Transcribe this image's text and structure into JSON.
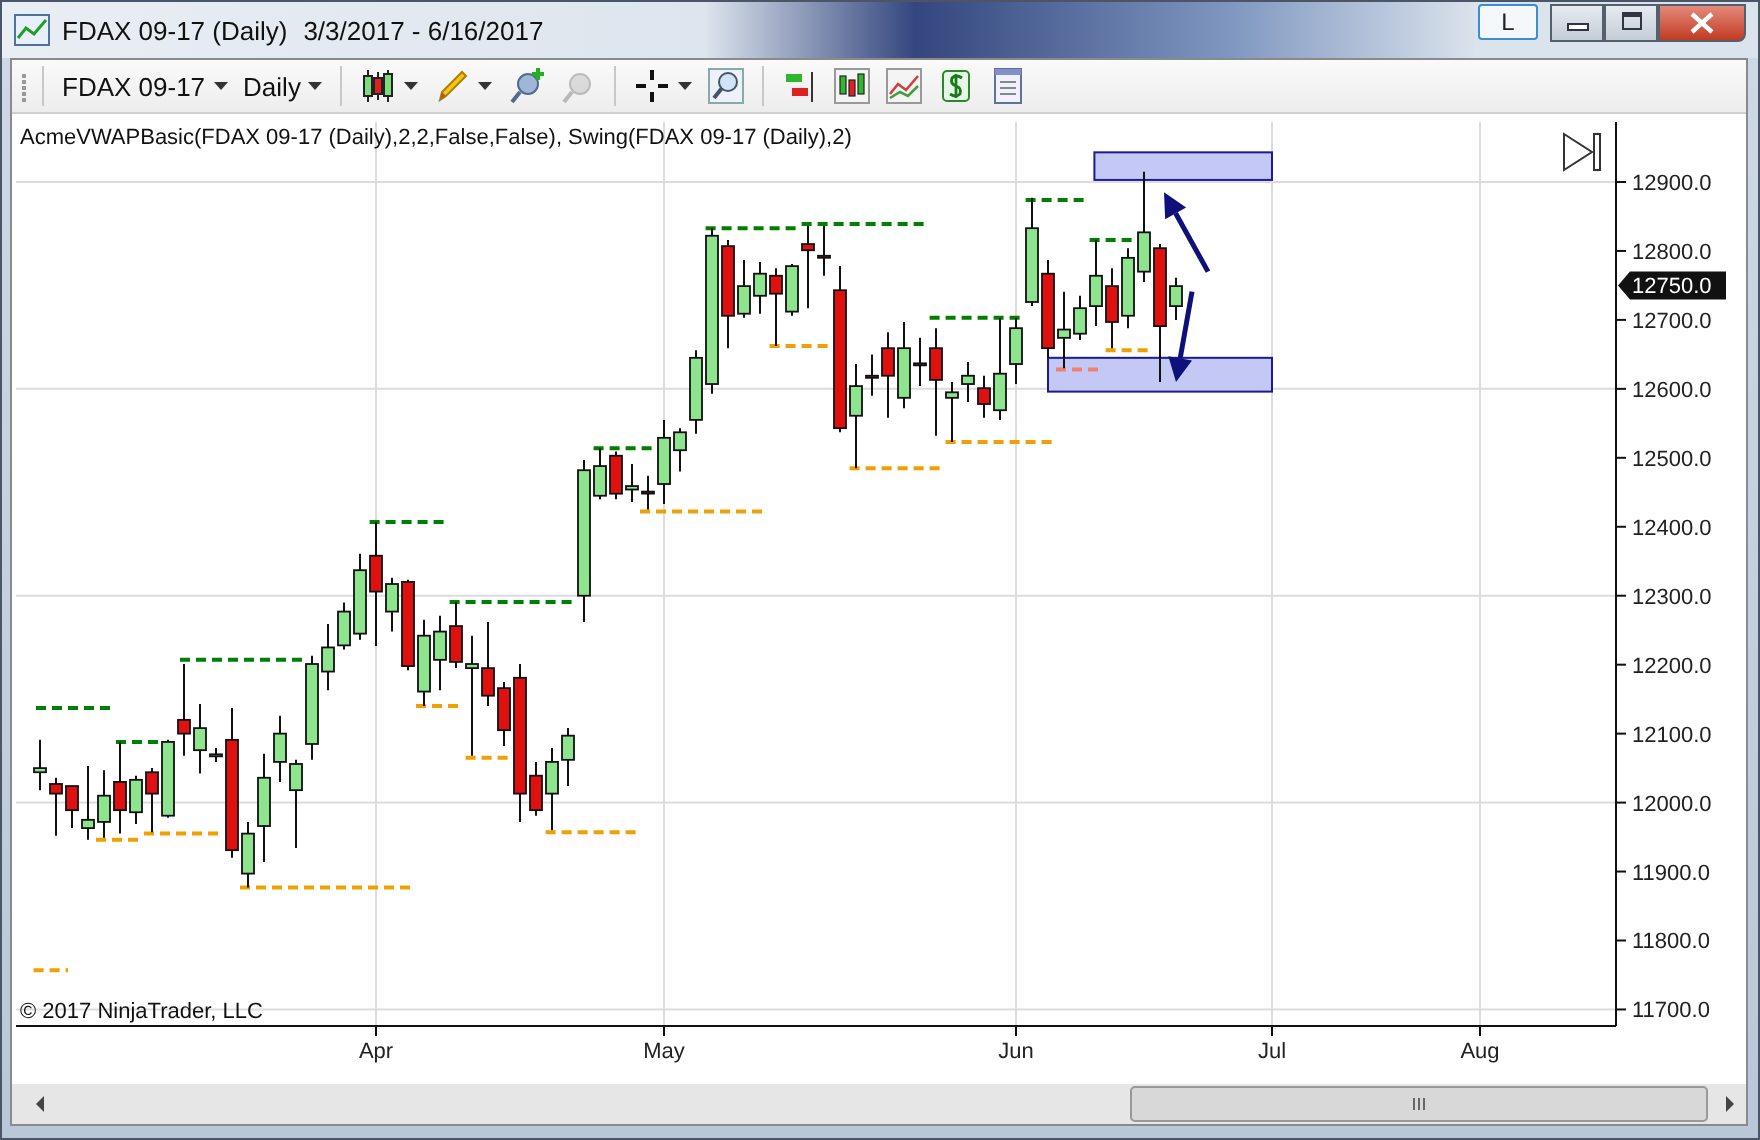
{
  "window": {
    "title": "FDAX 09-17 (Daily)",
    "date_range": "3/3/2017 - 6/16/2017",
    "caption_button": "L"
  },
  "toolbar": {
    "instrument": "FDAX 09-17",
    "interval": "Daily",
    "tool_groups": [
      [
        {
          "kind": "chart-style",
          "dropdown": true,
          "disabled": false
        },
        {
          "kind": "drawing",
          "dropdown": true,
          "disabled": false
        },
        {
          "kind": "add-pin",
          "dropdown": false,
          "disabled": false
        },
        {
          "kind": "remove-pin",
          "dropdown": false,
          "disabled": true
        }
      ],
      [
        {
          "kind": "crosshair",
          "dropdown": true,
          "disabled": false
        },
        {
          "kind": "zoom",
          "dropdown": false,
          "disabled": false
        }
      ],
      [
        {
          "kind": "strategy",
          "dropdown": false,
          "disabled": false
        },
        {
          "kind": "bars",
          "dropdown": false,
          "disabled": false
        },
        {
          "kind": "indicators",
          "dropdown": false,
          "disabled": false
        },
        {
          "kind": "dollar",
          "dropdown": false,
          "disabled": false
        },
        {
          "kind": "properties",
          "dropdown": false,
          "disabled": false
        }
      ]
    ]
  },
  "chart": {
    "indicator_label": "AcmeVWAPBasic(FDAX 09-17 (Daily),2,2,False,False), Swing(FDAX 09-17 (Daily),2)",
    "copyright": "© 2017 NinjaTrader, LLC",
    "price_labels": [
      "12900.0",
      "12800.0",
      "12700.0",
      "12600.0",
      "12500.0",
      "12400.0",
      "12300.0",
      "12200.0",
      "12100.0",
      "12000.0",
      "11900.0",
      "11800.0",
      "11700.0"
    ],
    "time_labels": [
      "Apr",
      "May",
      "Jun",
      "Jul",
      "Aug"
    ],
    "last_price": "12750.0"
  }
}
